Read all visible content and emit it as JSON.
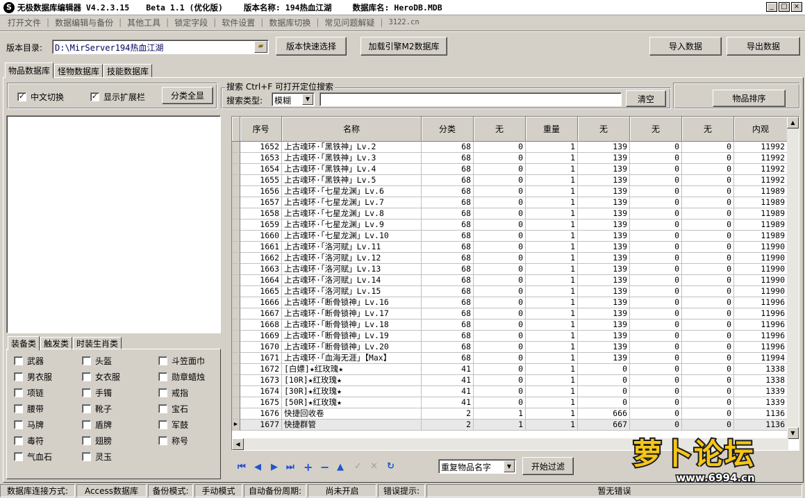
{
  "title": {
    "app": "无极数据库编辑器 V4.2.3.15",
    "build": "Beta 1.1 (优化版)",
    "version": "版本名称: 194热血江湖",
    "db": "数据库名: HeroDB.MDB"
  },
  "menu": [
    "打开文件",
    "数据编辑与备份",
    "其他工具",
    "锁定字段",
    "软件设置",
    "数据库切换",
    "常见问题解疑",
    "3122.cn"
  ],
  "toolbar": {
    "dir_label": "版本目录:",
    "dir_value": "D:\\MirServer194热血江湖",
    "quick_select": "版本快速选择",
    "load_m2": "加载引擎M2数据库",
    "import": "导入数据",
    "export": "导出数据"
  },
  "tabs": [
    "物品数据库",
    "怪物数据库",
    "技能数据库"
  ],
  "options": {
    "chinese": "中文切换",
    "show_ext": "显示扩展栏",
    "show_all": "分类全显"
  },
  "search": {
    "group_title": "搜索 Ctrl+F 可打开定位搜索",
    "type_label": "搜索类型:",
    "type_value": "模糊",
    "clear": "清空",
    "sort": "物品排序"
  },
  "cat_tabs": [
    "装备类",
    "触发类",
    "时装生肖类"
  ],
  "categories": [
    "武器",
    "头盔",
    "斗笠面巾",
    "男衣服",
    "女衣服",
    "勋章蜡烛",
    "项链",
    "手镯",
    "戒指",
    "腰带",
    "靴子",
    "宝石",
    "马牌",
    "盾牌",
    "军鼓",
    "毒符",
    "翅膀",
    "称号",
    "气血石",
    "灵玉"
  ],
  "columns": [
    "序号",
    "名称",
    "分类",
    "无",
    "重量",
    "无",
    "无",
    "无",
    "内观"
  ],
  "rows": [
    [
      "1652",
      "上古魂环·「黑铁神」Lv.2",
      "68",
      "0",
      "1",
      "139",
      "0",
      "0",
      "11992"
    ],
    [
      "1653",
      "上古魂环·「黑铁神」Lv.3",
      "68",
      "0",
      "1",
      "139",
      "0",
      "0",
      "11992"
    ],
    [
      "1654",
      "上古魂环·「黑铁神」Lv.4",
      "68",
      "0",
      "1",
      "139",
      "0",
      "0",
      "11992"
    ],
    [
      "1655",
      "上古魂环·「黑铁神」Lv.5",
      "68",
      "0",
      "1",
      "139",
      "0",
      "0",
      "11992"
    ],
    [
      "1656",
      "上古魂环·「七星龙渊」Lv.6",
      "68",
      "0",
      "1",
      "139",
      "0",
      "0",
      "11989"
    ],
    [
      "1657",
      "上古魂环·「七星龙渊」Lv.7",
      "68",
      "0",
      "1",
      "139",
      "0",
      "0",
      "11989"
    ],
    [
      "1658",
      "上古魂环·「七星龙渊」Lv.8",
      "68",
      "0",
      "1",
      "139",
      "0",
      "0",
      "11989"
    ],
    [
      "1659",
      "上古魂环·「七星龙渊」Lv.9",
      "68",
      "0",
      "1",
      "139",
      "0",
      "0",
      "11989"
    ],
    [
      "1660",
      "上古魂环·「七星龙渊」Lv.10",
      "68",
      "0",
      "1",
      "139",
      "0",
      "0",
      "11989"
    ],
    [
      "1661",
      "上古魂环·「洛河赋」Lv.11",
      "68",
      "0",
      "1",
      "139",
      "0",
      "0",
      "11990"
    ],
    [
      "1662",
      "上古魂环·「洛河赋」Lv.12",
      "68",
      "0",
      "1",
      "139",
      "0",
      "0",
      "11990"
    ],
    [
      "1663",
      "上古魂环·「洛河赋」Lv.13",
      "68",
      "0",
      "1",
      "139",
      "0",
      "0",
      "11990"
    ],
    [
      "1664",
      "上古魂环·「洛河赋」Lv.14",
      "68",
      "0",
      "1",
      "139",
      "0",
      "0",
      "11990"
    ],
    [
      "1665",
      "上古魂环·「洛河赋」Lv.15",
      "68",
      "0",
      "1",
      "139",
      "0",
      "0",
      "11990"
    ],
    [
      "1666",
      "上古魂环·「断骨锁神」Lv.16",
      "68",
      "0",
      "1",
      "139",
      "0",
      "0",
      "11996"
    ],
    [
      "1667",
      "上古魂环·「断骨锁神」Lv.17",
      "68",
      "0",
      "1",
      "139",
      "0",
      "0",
      "11996"
    ],
    [
      "1668",
      "上古魂环·「断骨锁神」Lv.18",
      "68",
      "0",
      "1",
      "139",
      "0",
      "0",
      "11996"
    ],
    [
      "1669",
      "上古魂环·「断骨锁神」Lv.19",
      "68",
      "0",
      "1",
      "139",
      "0",
      "0",
      "11996"
    ],
    [
      "1670",
      "上古魂环·「断骨锁神」Lv.20",
      "68",
      "0",
      "1",
      "139",
      "0",
      "0",
      "11996"
    ],
    [
      "1671",
      "上古魂环·「血海无涯」【Max】",
      "68",
      "0",
      "1",
      "139",
      "0",
      "0",
      "11994"
    ],
    [
      "1672",
      "[白嫖]★红玫瑰★",
      "41",
      "0",
      "1",
      "0",
      "0",
      "0",
      "1338"
    ],
    [
      "1673",
      "[10R]★红玫瑰★",
      "41",
      "0",
      "1",
      "0",
      "0",
      "0",
      "1338"
    ],
    [
      "1674",
      "[30R]★红玫瑰★",
      "41",
      "0",
      "1",
      "0",
      "0",
      "0",
      "1339"
    ],
    [
      "1675",
      "[50R]★红玫瑰★",
      "41",
      "0",
      "1",
      "0",
      "0",
      "0",
      "1339"
    ],
    [
      "1676",
      "快捷回收卷",
      "2",
      "1",
      "1",
      "666",
      "0",
      "0",
      "1136"
    ],
    [
      "1677",
      "快捷群管",
      "2",
      "1",
      "1",
      "667",
      "0",
      "0",
      "1136"
    ]
  ],
  "selected_row": "1677",
  "bottom": {
    "filter_value": "重复物品名字",
    "filter_button": "开始过滤"
  },
  "status": {
    "conn_label": "数据库连接方式:",
    "conn_value": "Access数据库",
    "backup_label": "备份模式:",
    "backup_value": "手动模式",
    "auto_label": "自动备份周期:",
    "auto_value": "尚未开启",
    "err_label": "错误提示:",
    "err_value": "暂无错误"
  },
  "watermark": {
    "brand": "萝卜论坛",
    "site": "www.6994.cn"
  }
}
